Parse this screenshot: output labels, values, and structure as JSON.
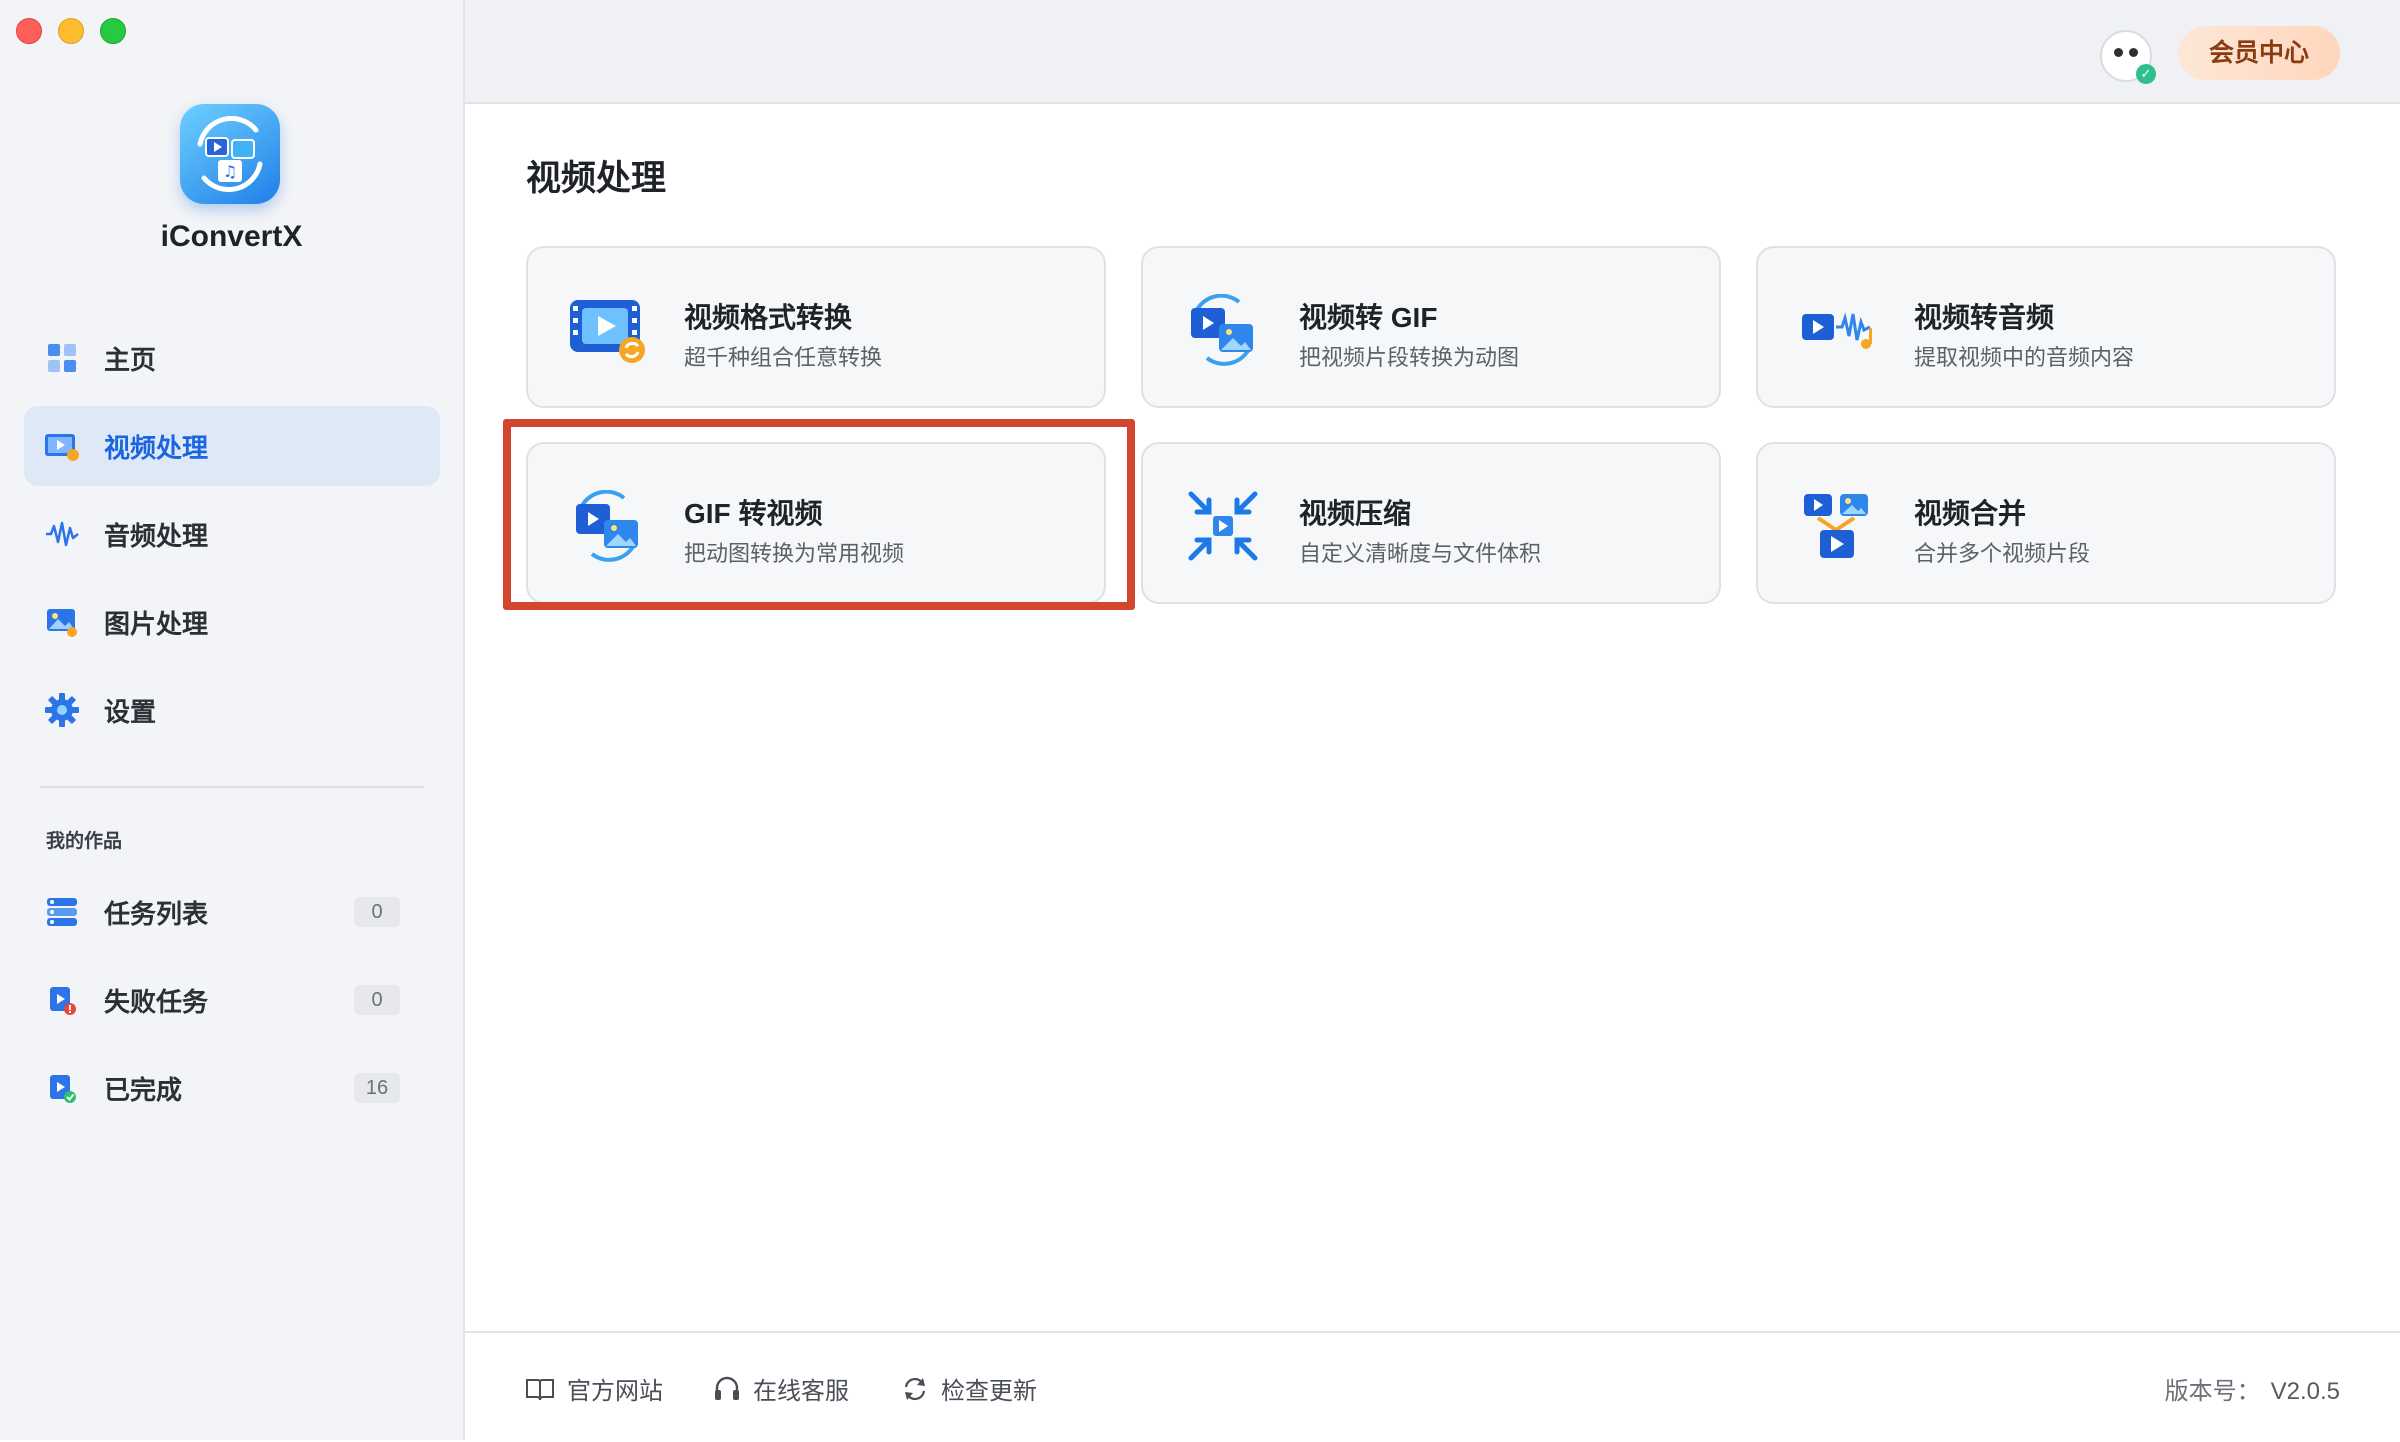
{
  "app": {
    "name": "iConvertX"
  },
  "sidebar": {
    "nav": [
      {
        "label": "主页",
        "icon": "home-icon"
      },
      {
        "label": "视频处理",
        "icon": "video-processing-icon",
        "active": true
      },
      {
        "label": "音频处理",
        "icon": "audio-wave-icon"
      },
      {
        "label": "图片处理",
        "icon": "image-processing-icon"
      },
      {
        "label": "设置",
        "icon": "gear-icon"
      }
    ],
    "works_title": "我的作品",
    "works": [
      {
        "label": "任务列表",
        "count": "0",
        "icon": "task-list-icon"
      },
      {
        "label": "失败任务",
        "count": "0",
        "icon": "failed-task-icon"
      },
      {
        "label": "已完成",
        "count": "16",
        "icon": "completed-icon"
      }
    ]
  },
  "topbar": {
    "vip_label": "会员中心"
  },
  "main": {
    "title": "视频处理",
    "cards": [
      {
        "title": "视频格式转换",
        "subtitle": "超千种组合任意转换",
        "icon": "video-format-convert-icon"
      },
      {
        "title": "视频转 GIF",
        "subtitle": "把视频片段转换为动图",
        "icon": "video-to-gif-icon"
      },
      {
        "title": "视频转音频",
        "subtitle": "提取视频中的音频内容",
        "icon": "video-to-audio-icon"
      },
      {
        "title": "GIF 转视频",
        "subtitle": "把动图转换为常用视频",
        "icon": "gif-to-video-icon"
      },
      {
        "title": "视频压缩",
        "subtitle": "自定义清晰度与文件体积",
        "icon": "video-compress-icon"
      },
      {
        "title": "视频合并",
        "subtitle": "合并多个视频片段",
        "icon": "video-merge-icon"
      }
    ]
  },
  "footer": {
    "website": "官方网站",
    "support": "在线客服",
    "update": "检查更新",
    "version_label": "版本号：",
    "version": "V2.0.5"
  },
  "colors": {
    "accent": "#1a66e0",
    "highlight": "#d2462e",
    "vip_text": "#8a3b12"
  }
}
